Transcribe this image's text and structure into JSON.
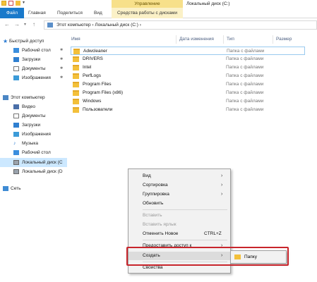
{
  "window": {
    "title": "Локальный диск (C:)",
    "manage_tab": "Управление"
  },
  "ribbon": {
    "tabs": [
      "Файл",
      "Главная",
      "Поделиться",
      "Вид"
    ],
    "disk_tools": "Средства работы с дисками"
  },
  "address": {
    "crumbs": "Этот компьютер  ›  Локальный диск (C:)  ›"
  },
  "columns": {
    "name": "Имя",
    "modified": "Дата изменения",
    "type": "Тип",
    "size": "Размер"
  },
  "files": [
    {
      "name": "Adwcleaner",
      "type": "Папка с файлами"
    },
    {
      "name": "DRIVERS",
      "type": "Папка с файлами"
    },
    {
      "name": "Intel",
      "type": "Папка с файлами"
    },
    {
      "name": "PerfLogs",
      "type": "Папка с файлами"
    },
    {
      "name": "Program Files",
      "type": "Папка с файлами"
    },
    {
      "name": "Program Files (x86)",
      "type": "Папка с файлами"
    },
    {
      "name": "Windows",
      "type": "Папка с файлами"
    },
    {
      "name": "Пользователи",
      "type": "Папка с файлами"
    }
  ],
  "nav": {
    "quick_access": "Быстрый доступ",
    "quick_items": [
      "Рабочий стол",
      "Загрузки",
      "Документы",
      "Изображения"
    ],
    "this_pc": "Этот компьютер",
    "pc_items": [
      "Видео",
      "Документы",
      "Загрузки",
      "Изображения",
      "Музыка",
      "Рабочий стол",
      "Локальный диск (C",
      "Локальный диск (D"
    ],
    "network": "Сеть"
  },
  "context_menu": {
    "view": "Вид",
    "sort": "Сортировка",
    "group": "Группировка",
    "refresh": "Обновить",
    "paste": "Вставить",
    "paste_shortcut": "Вставить ярлык",
    "undo": "Отменить Новое",
    "undo_shortcut": "CTRL+Z",
    "share": "Предоставить доступ к",
    "create": "Создать",
    "properties": "Свойства"
  },
  "submenu": {
    "folder": "Папку"
  },
  "colors": {
    "accent": "#1979ca",
    "highlight_border": "#c8252c",
    "selection": "#cce8ff"
  }
}
